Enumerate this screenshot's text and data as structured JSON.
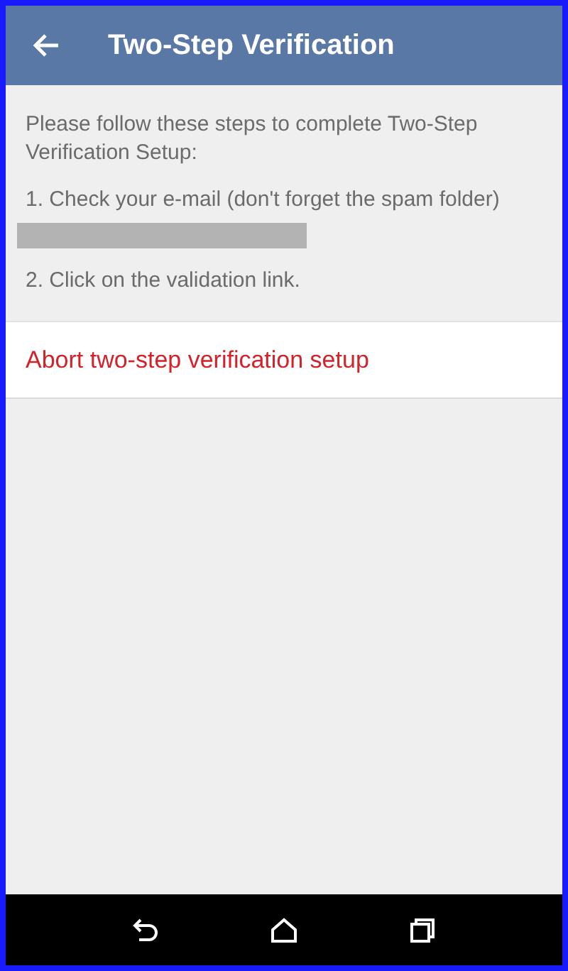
{
  "app_bar": {
    "title": "Two-Step Verification"
  },
  "instructions": {
    "intro": "Please follow these steps to complete Two-Step Verification Setup:",
    "steps": [
      "1. Check your e-mail (don't forget the spam folder)",
      "2. Click on the validation link."
    ],
    "redacted_email": true
  },
  "abort_action": {
    "label": "Abort two-step verification setup"
  }
}
